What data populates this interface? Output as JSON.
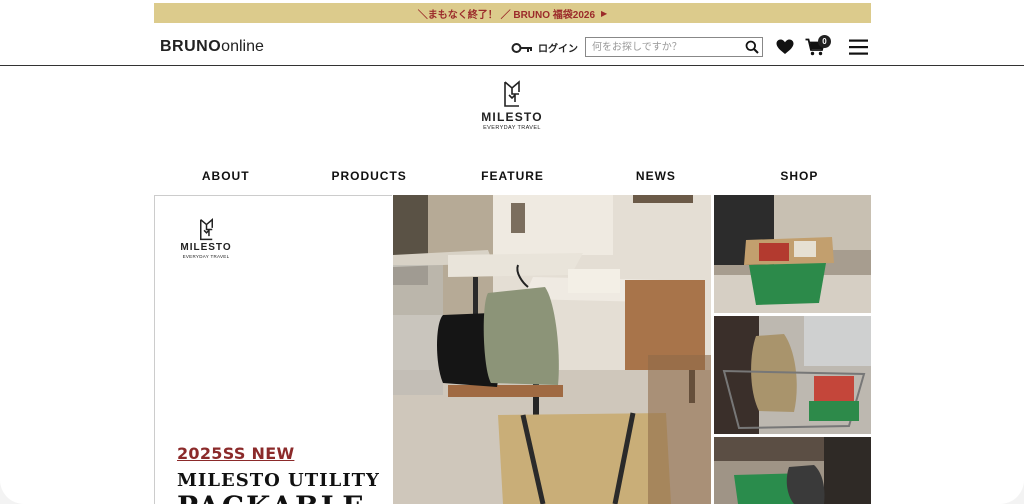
{
  "announcement": {
    "text": "＼まもなく終了！ ／ BRUNO 福袋2026",
    "arrow": "▶"
  },
  "header": {
    "logo_main": "BRUNO",
    "logo_suffix": "online",
    "login_label": "ログイン",
    "search_placeholder": "何をお探しですか？",
    "cart_count": "0",
    "icons": [
      "key-icon",
      "search-icon",
      "heart-icon",
      "cart-icon",
      "menu-icon"
    ]
  },
  "brand": {
    "name": "MILESTO",
    "tagline": "EVERYDAY TRAVEL"
  },
  "nav": {
    "items": [
      "ABOUT",
      "PRODUCTS",
      "FEATURE",
      "NEWS",
      "SHOP"
    ]
  },
  "hero": {
    "brand_name": "MILESTO",
    "brand_tagline": "EVERYDAY TRAVEL",
    "label": "2025SS NEW",
    "title_line1": "MILESTO UTILITY",
    "title_line2": "PACKABLE"
  },
  "colors": {
    "announce_bg": "#dccb8c",
    "announce_text": "#9b2a2a",
    "accent_red": "#8b2a2a",
    "text": "#111111"
  }
}
